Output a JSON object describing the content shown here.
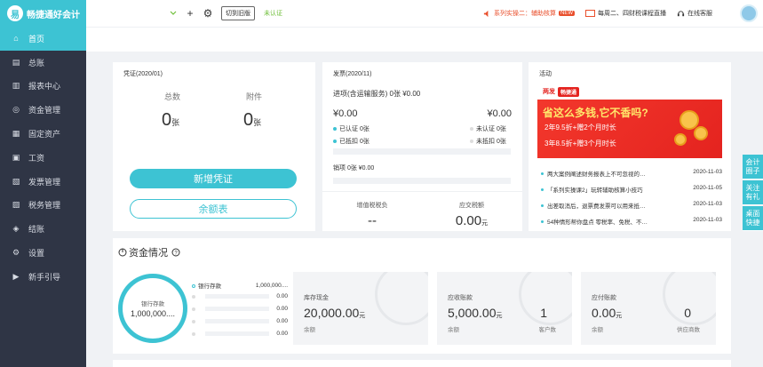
{
  "logo": {
    "text": "畅捷通好会计",
    "mark": "易"
  },
  "sidebar": {
    "items": [
      {
        "label": "首页",
        "icon": "home-icon",
        "glyph": "⌂"
      },
      {
        "label": "总账",
        "icon": "ledger-icon",
        "glyph": "▤"
      },
      {
        "label": "报表中心",
        "icon": "chart-icon",
        "glyph": "▥"
      },
      {
        "label": "资金管理",
        "icon": "money-icon",
        "glyph": "◎"
      },
      {
        "label": "固定资产",
        "icon": "asset-icon",
        "glyph": "▦"
      },
      {
        "label": "工资",
        "icon": "salary-icon",
        "glyph": "▣"
      },
      {
        "label": "发票管理",
        "icon": "invoice-icon",
        "glyph": "▧"
      },
      {
        "label": "税务管理",
        "icon": "tax-icon",
        "glyph": "▨"
      },
      {
        "label": "结账",
        "icon": "close-books-icon",
        "glyph": "◈"
      },
      {
        "label": "设置",
        "icon": "gear-icon",
        "glyph": "⚙"
      },
      {
        "label": "新手引导",
        "icon": "guide-icon",
        "glyph": "▶"
      }
    ]
  },
  "topbar": {
    "add_glyph": "+",
    "settings_glyph": "⚙",
    "switch_label": "切到旧版",
    "status": "未认证",
    "live": "系列实操二：辅助核算",
    "live_badge": "NEW",
    "course": "每周二、四财税课程直播",
    "service": "在线客服"
  },
  "voucher": {
    "title": "凭证(2020/01)",
    "total_label": "总数",
    "total_value": "0",
    "attach_label": "附件",
    "attach_value": "0",
    "unit": "张",
    "new_button": "新增凭证",
    "balance_button": "余额表"
  },
  "invoice": {
    "title": "发票(2020/11)",
    "summary": "进项(含运输服务) 0张 ¥0.00",
    "in_amount": "¥0.00",
    "out_amount": "¥0.00",
    "verified": "已认证  0张",
    "unverified": "未认证  0张",
    "deducted": "已抵扣  0张",
    "undeducted": "未抵扣  0张",
    "sales": "销项     0张   ¥0.00",
    "vat_label": "增值税税负",
    "vat_value": "--",
    "tax_due_label": "应交税额",
    "tax_due_value": "0.00",
    "currency_unit": "元"
  },
  "activity": {
    "title": "活动",
    "banner": {
      "brand": "两发",
      "brand2": "畅捷通",
      "headline": "省这么多钱,它不香吗?",
      "line1": "2年9.5折+赠2个月时长",
      "line2": "3年8.5折+赠3个月时长"
    },
    "items": [
      {
        "text": "两大案例阐述财务报表上不可忽视的…",
        "date": "2020-11-03"
      },
      {
        "text": "「系列实操课2」玩转辅助核算小技巧",
        "date": "2020-11-05"
      },
      {
        "text": "出差取消后，退票费发票可以用来抵…",
        "date": "2020-11-03"
      },
      {
        "text": "54种情形帮你盘点 零税率、免税、不…",
        "date": "2020-11-03"
      }
    ]
  },
  "float": [
    {
      "label": "会计圈子"
    },
    {
      "label": "关注有礼"
    },
    {
      "label": "桌面快捷"
    }
  ],
  "funds": {
    "title": "资金情况",
    "ring_label": "银行存款",
    "ring_value": "1,000,000....",
    "legend": [
      {
        "label": "银行存款",
        "value": "1,000,000...."
      },
      {
        "label": "",
        "value": "0.00"
      },
      {
        "label": "",
        "value": "0.00"
      },
      {
        "label": "",
        "value": "0.00"
      },
      {
        "label": "",
        "value": "0.00"
      }
    ],
    "boxes": [
      {
        "label": "库存现金",
        "value": "20,000.00",
        "sub": "余额",
        "count": "",
        "count_label": ""
      },
      {
        "label": "应收账款",
        "value": "5,000.00",
        "sub": "余额",
        "count": "1",
        "count_label": "客户数"
      },
      {
        "label": "应付账款",
        "value": "0.00",
        "sub": "余额",
        "count": "0",
        "count_label": "供应商数"
      }
    ],
    "unit": "元"
  },
  "colors": {
    "accent": "#3dc3d3",
    "sidebar": "#2f3545",
    "banner": "#e4231f"
  }
}
